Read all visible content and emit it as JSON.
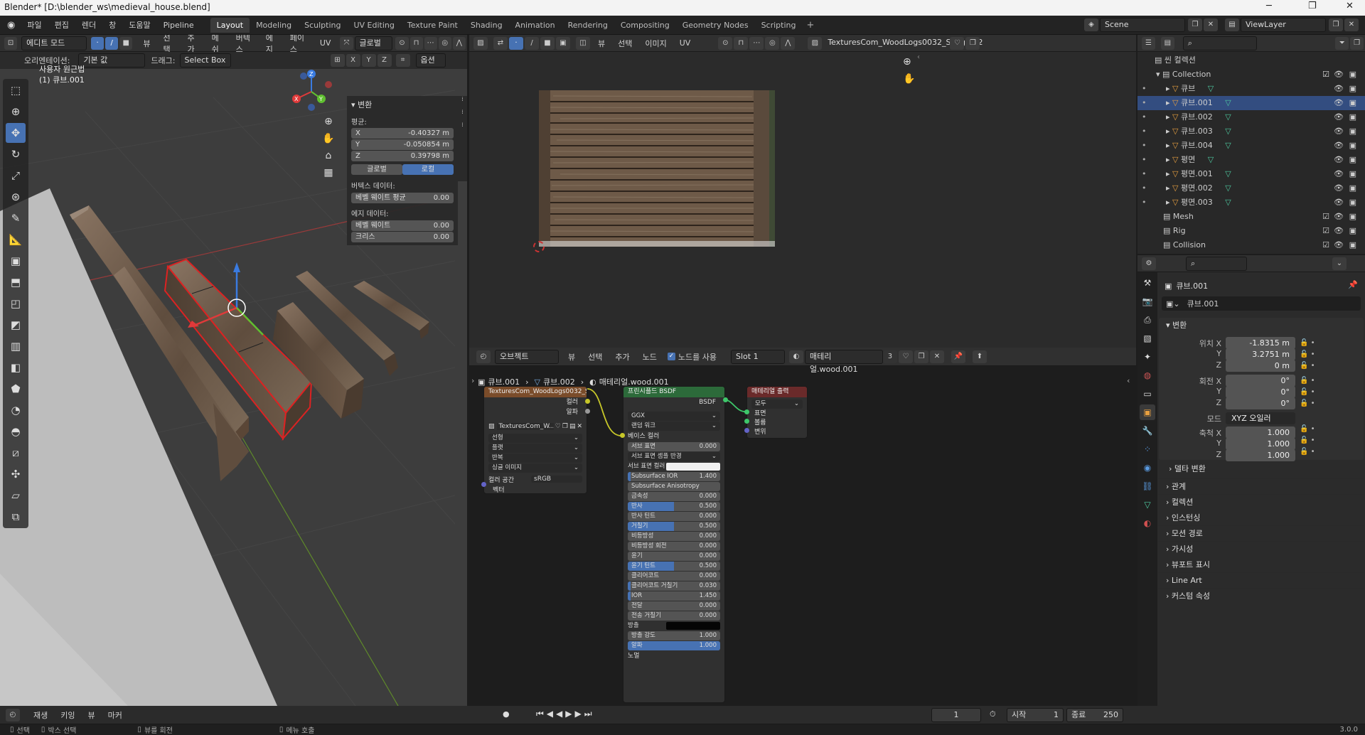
{
  "window": {
    "title": "Blender* [D:\\blender_ws\\medieval_house.blend]"
  },
  "menu": [
    "파일",
    "편집",
    "렌더",
    "창",
    "도움말",
    "Pipeline"
  ],
  "workspaces": [
    "Layout",
    "Modeling",
    "Sculpting",
    "UV Editing",
    "Texture Paint",
    "Shading",
    "Animation",
    "Rendering",
    "Compositing",
    "Geometry Nodes",
    "Scripting"
  ],
  "scene": {
    "name": "Scene",
    "view_layer": "ViewLayer"
  },
  "viewport": {
    "mode": "에디트 모드",
    "menus": [
      "뷰",
      "선택",
      "추가",
      "메쉬",
      "버텍스",
      "에지",
      "페이스",
      "UV"
    ],
    "transform_orientation": "글로벌",
    "orientation_label": "오리엔테이션:",
    "orientation_value": "기본 값",
    "drag_label": "드래그:",
    "drag_value": "Select Box",
    "options": "옵션",
    "view_name": "사용자 원근법",
    "object_name": "(1) 큐브.001",
    "axes": [
      "X",
      "Y",
      "Z"
    ]
  },
  "npanel": {
    "section": "변환",
    "median": "평균:",
    "x_label": "X",
    "x": "-0.40327 m",
    "y_label": "Y",
    "y": "-0.050854 m",
    "z_label": "Z",
    "z": "0.39798 m",
    "global": "글로벌",
    "local": "로컬",
    "vertex_data": "버텍스 데이터:",
    "bevel_weight_avg": "베벨 웨이트 평균",
    "bevel_weight_avg_val": "0.00",
    "edge_data": "에지 데이터:",
    "bevel_weight": "베벨 웨이트",
    "bevel_weight_val": "0.00",
    "crease": "크리스",
    "crease_val": "0.00"
  },
  "image_editor": {
    "menus": [
      "뷰",
      "선택",
      "이미지",
      "UV"
    ],
    "image_name": "TexturesCom_WoodLogs0032_S.jpg.002"
  },
  "node_editor": {
    "object": "오브젝트",
    "menus": [
      "뷰",
      "선택",
      "추가",
      "노드"
    ],
    "use_nodes": "노드를 사용",
    "slot": "Slot 1",
    "material": "매테리얼.wood.001",
    "users": "3",
    "breadcrumb": [
      "큐브.001",
      "큐브.002",
      "매테리얼.wood.001"
    ]
  },
  "image_node": {
    "title": "TexturesCom_WoodLogs0032_S.jpg.00",
    "out_color": "컬러",
    "out_alpha": "알파",
    "image": "TexturesCom_W...",
    "interp": "선형",
    "proj": "플랫",
    "ext": "반복",
    "source": "싱글 이미지",
    "colorspace_label": "컬러 공간",
    "colorspace": "sRGB",
    "vector": "벡터"
  },
  "bsdf_node": {
    "title": "프린시플드 BSDF",
    "out": "BSDF",
    "distribution": "GGX",
    "sss_method": "랜덤 워크",
    "base_color": "베이스 컬러",
    "props": [
      {
        "label": "서브 표면",
        "value": "0.000",
        "fill": 0
      },
      {
        "label": "서브 표면 셈플 반경",
        "value": "",
        "fill": 0,
        "dropdown": true
      },
      {
        "label": "서브 표면 컬러",
        "value": "",
        "fill": 0,
        "white": true
      },
      {
        "label": "Subsurface IOR",
        "value": "1.400",
        "fill": 0.03
      },
      {
        "label": "Subsurface Anisotropy",
        "value": "0.000",
        "fill": 0
      },
      {
        "label": "금속성",
        "value": "0.000",
        "fill": 0
      },
      {
        "label": "반사",
        "value": "0.500",
        "fill": 0.5
      },
      {
        "label": "반사 틴트",
        "value": "0.000",
        "fill": 0
      },
      {
        "label": "거칠기",
        "value": "0.500",
        "fill": 0.5
      },
      {
        "label": "비등방성",
        "value": "0.000",
        "fill": 0
      },
      {
        "label": "비등방성 회전",
        "value": "0.000",
        "fill": 0
      },
      {
        "label": "윤기",
        "value": "0.000",
        "fill": 0
      },
      {
        "label": "윤기 틴트",
        "value": "0.500",
        "fill": 0.5
      },
      {
        "label": "클리어코트",
        "value": "0.000",
        "fill": 0
      },
      {
        "label": "클리어코트 거칠기",
        "value": "0.030",
        "fill": 0.03
      },
      {
        "label": "IOR",
        "value": "1.450",
        "fill": 0.03
      },
      {
        "label": "전달",
        "value": "0.000",
        "fill": 0
      },
      {
        "label": "전송 거칠기",
        "value": "0.000",
        "fill": 0
      },
      {
        "label": "방출",
        "value": "",
        "fill": 0,
        "black": true
      },
      {
        "label": "방출 강도",
        "value": "1.000",
        "fill": 0
      },
      {
        "label": "알파",
        "value": "1.000",
        "fill": 1
      }
    ],
    "normal": "노멀"
  },
  "output_node": {
    "title": "매테리얼 출력",
    "target": "모두",
    "surface": "표면",
    "volume": "볼륨",
    "displacement": "변위"
  },
  "timeline": {
    "menus": [
      "재생",
      "키잉",
      "뷰",
      "마커"
    ],
    "frame": "1",
    "start_label": "시작",
    "start": "1",
    "end_label": "종료",
    "end": "250"
  },
  "statusbar": {
    "select": "선택",
    "box_select": "박스 선택",
    "rotate": "뷰를 회전",
    "menu": "메뉴 호출",
    "version": "3.0.0"
  },
  "outliner": {
    "scene_collection": "씬 컬렉션",
    "collection": "Collection",
    "items": [
      "큐브",
      "큐브.001",
      "큐브.002",
      "큐브.003",
      "큐브.004",
      "평면",
      "평면.001",
      "평면.002",
      "평면.003"
    ],
    "selected": 1,
    "others": [
      "Mesh",
      "Rig",
      "Collision"
    ]
  },
  "properties": {
    "object": "큐브.001",
    "object_field": "큐브.001",
    "transform": "변환",
    "location_label": "위치 X",
    "loc_x": "-1.8315 m",
    "loc_y": "3.2751 m",
    "loc_z": "0 m",
    "rotation_label": "회전 X",
    "rot_x": "0°",
    "rot_y": "0°",
    "rot_z": "0°",
    "mode_label": "모드",
    "mode": "XYZ 오일러",
    "scale_label": "축척 X",
    "scale_x": "1.000",
    "scale_y": "1.000",
    "scale_z": "1.000",
    "y": "Y",
    "z": "Z",
    "delta": "델타 변환",
    "sections": [
      "관계",
      "컬렉션",
      "인스턴싱",
      "모션 경로",
      "가시성",
      "뷰포트 표시",
      "Line Art",
      "커스텀 속성"
    ]
  }
}
